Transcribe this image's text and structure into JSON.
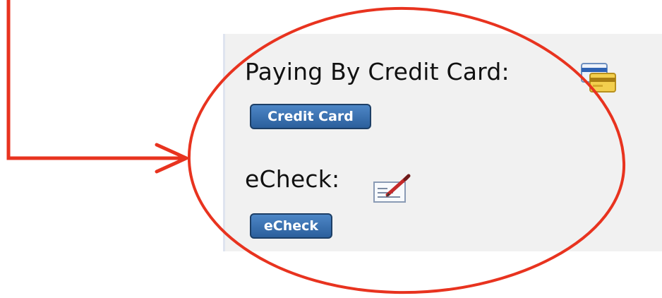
{
  "payment_options": {
    "credit_card": {
      "label": "Paying By Credit Card:",
      "icon": "credit-card-icon",
      "button_label": "Credit Card"
    },
    "echeck": {
      "label": "eCheck:",
      "icon": "check-pen-icon",
      "button_label": "eCheck"
    }
  },
  "colors": {
    "panel_background": "#f1f1f1",
    "button_blue": "#2b5f9c",
    "annotation_red": "#e8331f"
  }
}
